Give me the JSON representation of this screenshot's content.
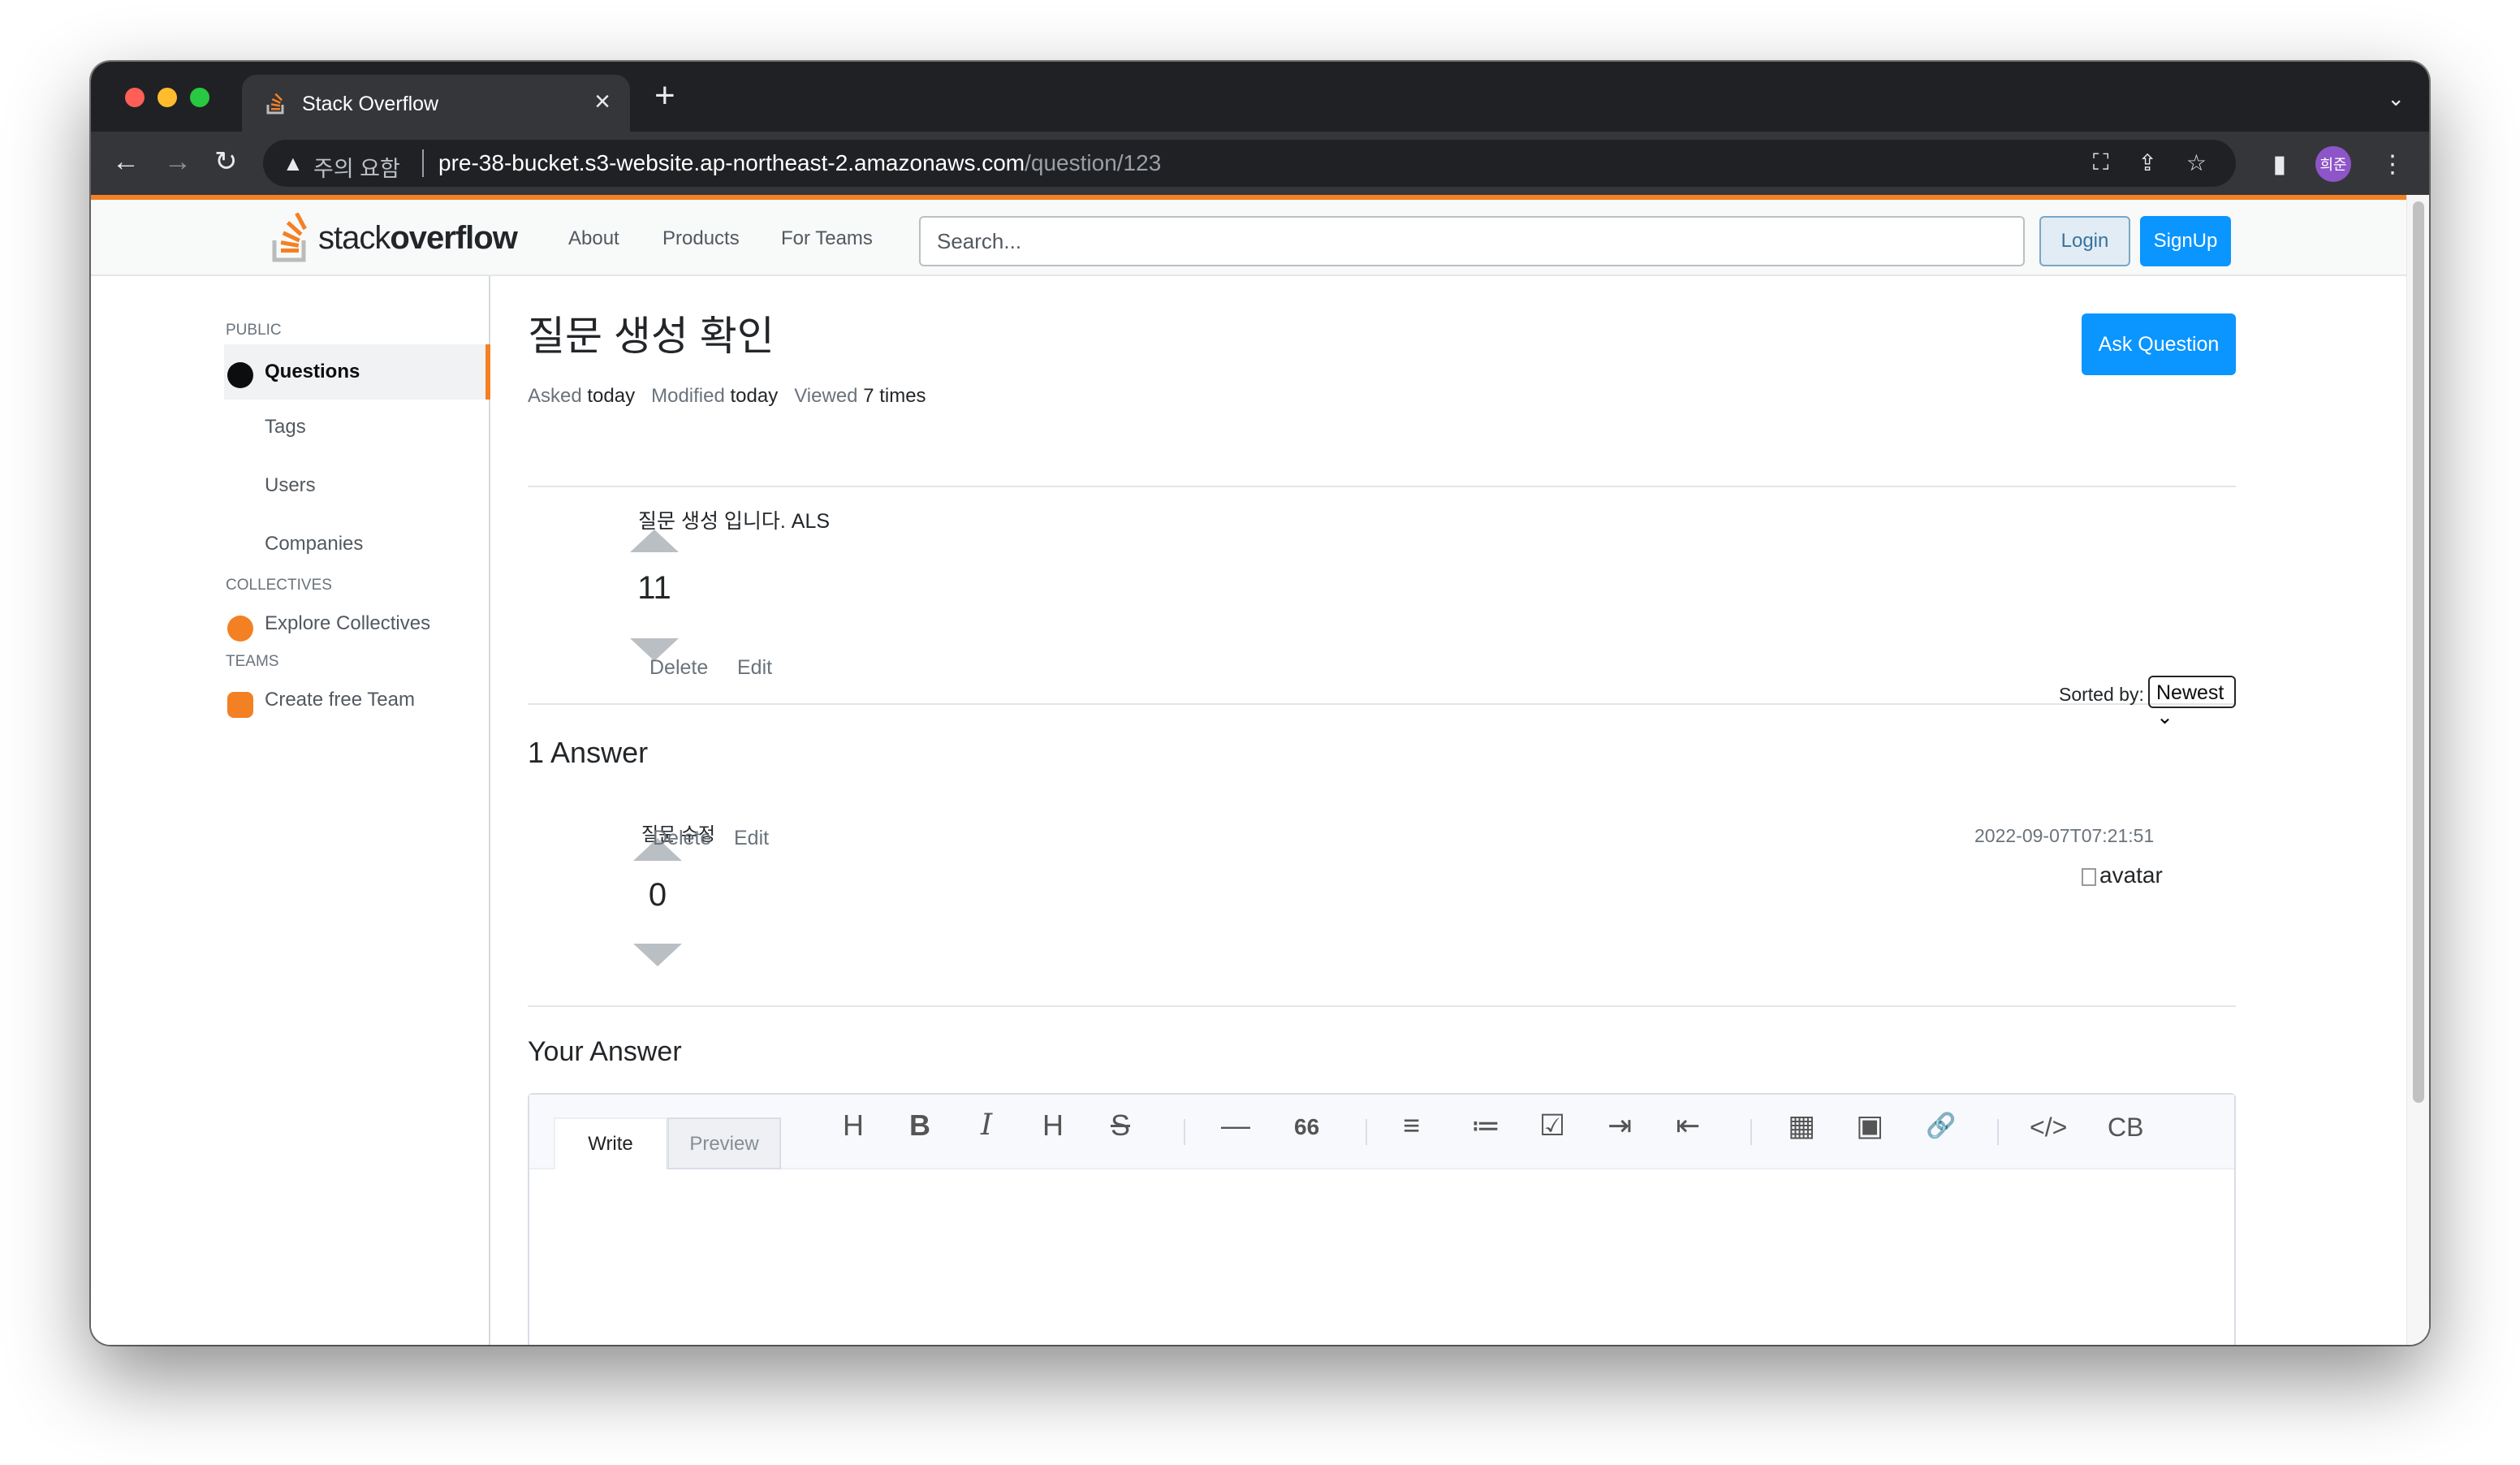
{
  "browser": {
    "tab_title": "Stack Overflow",
    "tab_close": "×",
    "new_tab": "+",
    "warning_label": "주의 요함",
    "url_host": "pre-38-bucket.s3-website.ap-northeast-2.amazonaws.com",
    "url_path": "/question/123",
    "profile_label": "희준"
  },
  "header": {
    "logo_light": "stack",
    "logo_bold": "overflow",
    "nav": [
      "About",
      "Products",
      "For Teams"
    ],
    "search_placeholder": "Search...",
    "login": "Login",
    "signup": "SignUp"
  },
  "sidebar": {
    "public_head": "PUBLIC",
    "items": [
      "Questions",
      "Tags",
      "Users",
      "Companies"
    ],
    "collectives_head": "COLLECTIVES",
    "explore_collectives": "Explore Collectives",
    "teams_head": "TEAMS",
    "create_team": "Create free Team"
  },
  "question": {
    "title": "질문 생성 확인",
    "ask_button": "Ask Question",
    "asked_label": "Asked",
    "asked_value": "today",
    "modified_label": "Modified",
    "modified_value": "today",
    "viewed_label": "Viewed",
    "viewed_value": "7 times",
    "votes": "11",
    "body": "질문 생성 입니다. ALS",
    "delete": "Delete",
    "edit": "Edit"
  },
  "answers": {
    "count_label": "1 Answer",
    "sorted_label": "Sorted by:",
    "sort_value": "Newest",
    "items": [
      {
        "votes": "0",
        "body": "질문 수정",
        "delete": "Delete",
        "edit": "Edit",
        "timestamp": "2022-09-07T07:21:51",
        "avatar_alt": "avatar"
      }
    ]
  },
  "your_answer": {
    "heading": "Your Answer",
    "tab_write": "Write",
    "tab_preview": "Preview",
    "toolbar_glyphs": [
      "H",
      "B",
      "I",
      "H",
      "S",
      "—",
      "66",
      "≡",
      "≔",
      "☑",
      "⇥",
      "⇤",
      "▦",
      "▣",
      "🔗",
      "</>",
      "CB"
    ]
  }
}
